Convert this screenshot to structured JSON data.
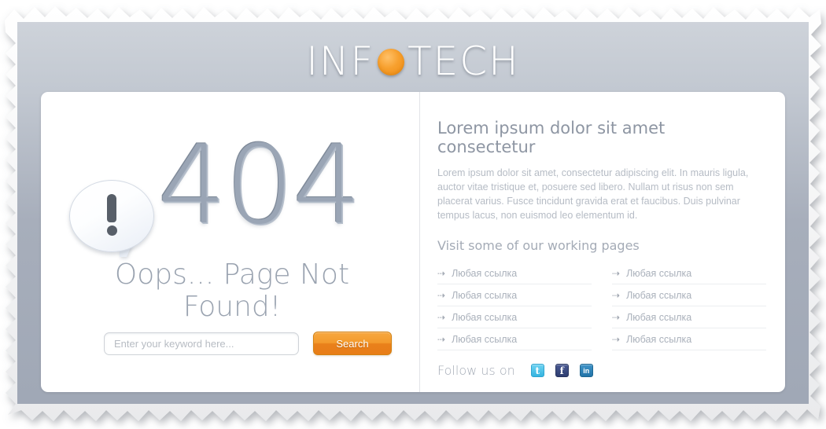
{
  "brand": {
    "name_before": "INF",
    "name_after": "TECH",
    "dot_icon": "orange-circle-icon",
    "accent_color": "#f39a2c"
  },
  "error": {
    "code": "404",
    "headline": "Oops... Page Not Found!",
    "bubble_icon": "exclamation-speech-bubble-icon",
    "code_color": "#9aa5b5"
  },
  "search": {
    "placeholder": "Enter your keyword here...",
    "value": "",
    "button_label": "Search",
    "button_color": "#f39a2c"
  },
  "info": {
    "title": "Lorem ipsum dolor sit amet consectetur",
    "paragraph": "Lorem ipsum dolor sit amet, consectetur adipiscing elit. In mauris ligula, auctor vitae tristique et, posuere sed libero. Nullam ut risus non sem placerat varius. Fusce tincidunt gravida erat et faucibus. Duis pulvinar tempus lacus, non euismod leo elementum id.",
    "links_heading": "Visit some of our working pages"
  },
  "links": {
    "arrow_glyph": "⇢",
    "left": [
      {
        "label": "Любая ссылка"
      },
      {
        "label": "Любая ссылка"
      },
      {
        "label": "Любая ссылка"
      },
      {
        "label": "Любая ссылка"
      }
    ],
    "right": [
      {
        "label": "Любая ссылка"
      },
      {
        "label": "Любая ссылка"
      },
      {
        "label": "Любая ссылка"
      },
      {
        "label": "Любая ссылка"
      }
    ]
  },
  "follow": {
    "label": "Follow us on",
    "items": [
      {
        "icon": "twitter-icon",
        "glyph": "t",
        "color": "#35b4e0"
      },
      {
        "icon": "facebook-icon",
        "glyph": "f",
        "color": "#2e3d70"
      },
      {
        "icon": "linkedin-icon",
        "glyph": "in",
        "color": "#2274a8"
      }
    ]
  }
}
